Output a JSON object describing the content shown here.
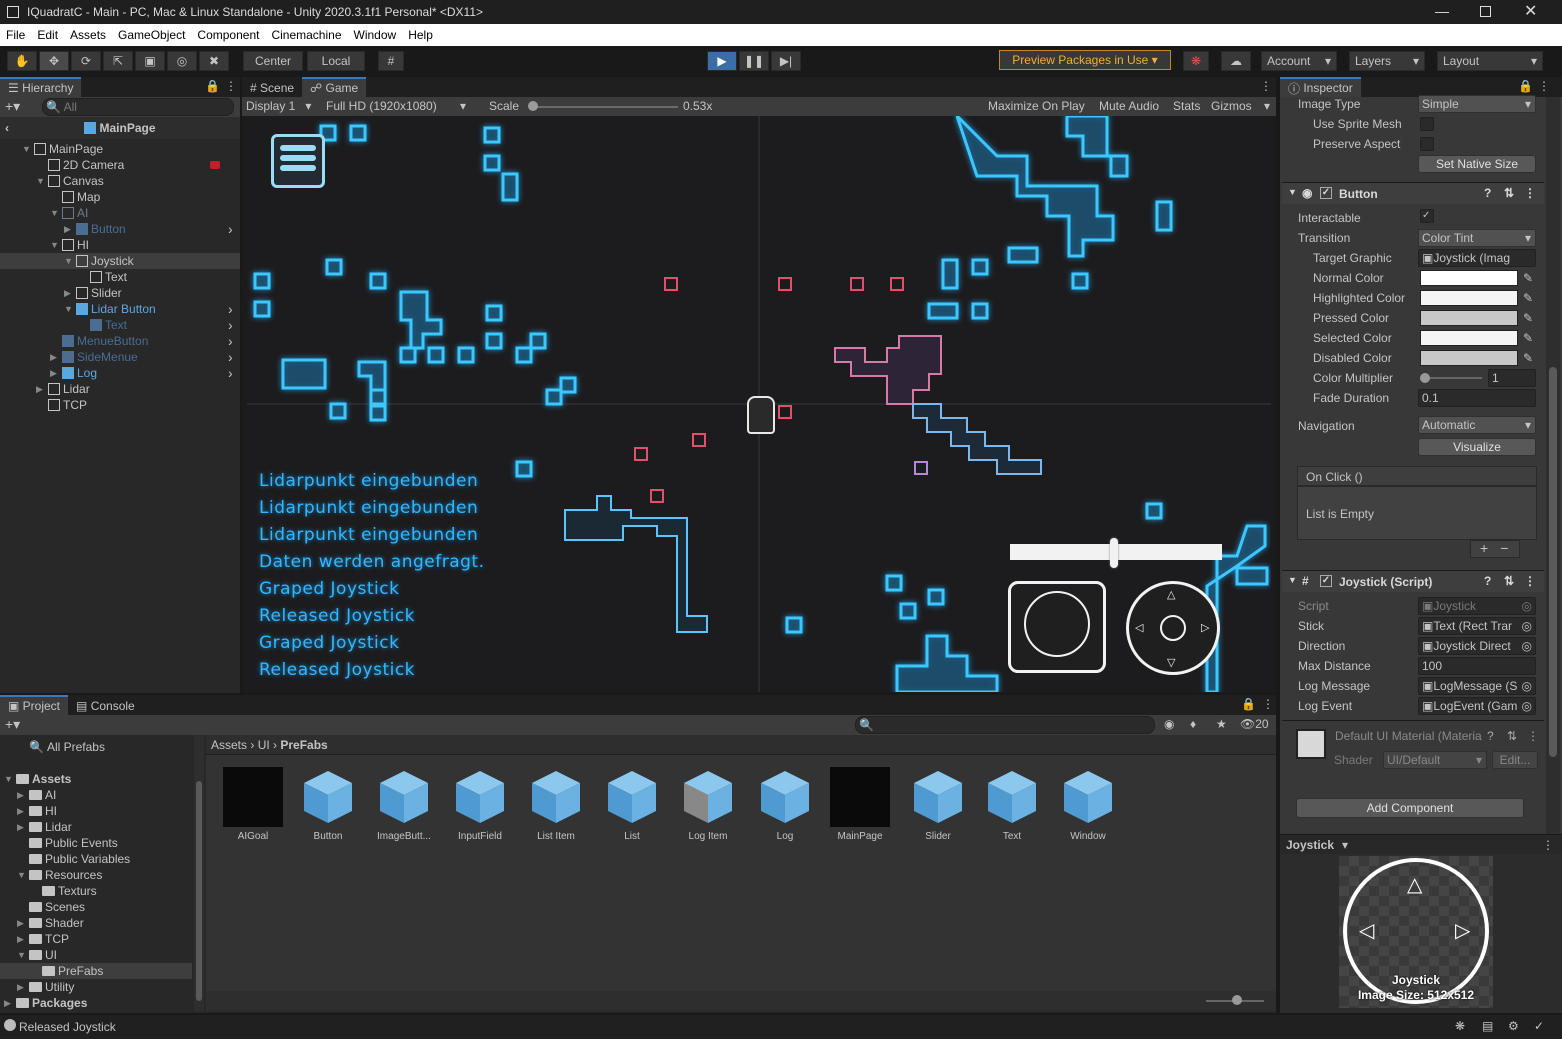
{
  "window": {
    "title": "IQuadratC - Main - PC, Mac & Linux Standalone - Unity 2020.3.1f1 Personal* <DX11>"
  },
  "menu": [
    "File",
    "Edit",
    "Assets",
    "GameObject",
    "Component",
    "Cinemachine",
    "Window",
    "Help"
  ],
  "toolbar": {
    "pivot": "Center",
    "space": "Local",
    "packages": "Preview Packages in Use",
    "account": "Account",
    "layers": "Layers",
    "layout": "Layout"
  },
  "hierarchy": {
    "tab": "Hierarchy",
    "search_placeholder": "All",
    "scene": "MainPage",
    "rows": [
      {
        "label": "MainPage",
        "indent": 0
      },
      {
        "label": "2D Camera",
        "indent": 1
      },
      {
        "label": "Canvas",
        "indent": 1
      },
      {
        "label": "Map",
        "indent": 2
      },
      {
        "label": "AI",
        "indent": 2
      },
      {
        "label": "Button",
        "indent": 3
      },
      {
        "label": "HI",
        "indent": 2
      },
      {
        "label": "Joystick",
        "indent": 3
      },
      {
        "label": "Text",
        "indent": 4
      },
      {
        "label": "Slider",
        "indent": 3
      },
      {
        "label": "Lidar Button",
        "indent": 3
      },
      {
        "label": "Text",
        "indent": 4
      },
      {
        "label": "MenueButton",
        "indent": 2
      },
      {
        "label": "SideMenue",
        "indent": 2
      },
      {
        "label": "Log",
        "indent": 2
      },
      {
        "label": "Lidar",
        "indent": 1
      },
      {
        "label": "TCP",
        "indent": 1
      }
    ]
  },
  "scene_tabs": {
    "scene": "Scene",
    "game": "Game"
  },
  "game_bar": {
    "display": "Display 1",
    "resolution": "Full HD (1920x1080)",
    "scale_label": "Scale",
    "scale_value": "0.53x",
    "maximize": "Maximize On Play",
    "mute": "Mute Audio",
    "stats": "Stats",
    "gizmos": "Gizmos"
  },
  "game_log": [
    "Lidarpunkt eingebunden",
    "Lidarpunkt eingebunden",
    "Lidarpunkt eingebunden",
    "Daten werden angefragt.",
    "Graped Joystick",
    "Released Joystick",
    "Graped Joystick",
    "Released Joystick"
  ],
  "inspector": {
    "tab": "Inspector",
    "image": {
      "image_type_label": "Image Type",
      "image_type": "Simple",
      "use_sprite_mesh": "Use Sprite Mesh",
      "preserve_aspect": "Preserve Aspect",
      "set_native": "Set Native Size"
    },
    "button": {
      "title": "Button",
      "interactable": "Interactable",
      "transition_label": "Transition",
      "transition": "Color Tint",
      "target_graphic_label": "Target Graphic",
      "target_graphic": "Joystick (Imag",
      "colors": [
        {
          "label": "Normal Color",
          "color": "#ffffff"
        },
        {
          "label": "Highlighted Color",
          "color": "#f5f5f5"
        },
        {
          "label": "Pressed Color",
          "color": "#c8c8c8"
        },
        {
          "label": "Selected Color",
          "color": "#f5f5f5"
        },
        {
          "label": "Disabled Color",
          "color": "#c8c8c8"
        }
      ],
      "color_multiplier_label": "Color Multiplier",
      "color_multiplier": "1",
      "fade_label": "Fade Duration",
      "fade": "0.1",
      "navigation_label": "Navigation",
      "navigation": "Automatic",
      "visualize": "Visualize",
      "onclick": "On Click ()",
      "list_empty": "List is Empty"
    },
    "joystick": {
      "title": "Joystick (Script)",
      "rows": [
        {
          "label": "Script",
          "value": "Joystick"
        },
        {
          "label": "Stick",
          "value": "Text (Rect Trar"
        },
        {
          "label": "Direction",
          "value": "Joystick Direct"
        },
        {
          "label": "Max Distance",
          "value": "100"
        },
        {
          "label": "Log Message",
          "value": "LogMessage (S"
        },
        {
          "label": "Log Event",
          "value": "LogEvent (Gam"
        }
      ]
    },
    "material": {
      "name": "Default UI Material (Materia",
      "shader_label": "Shader",
      "shader": "UI/Default",
      "edit": "Edit..."
    },
    "add_component": "Add Component",
    "preview": {
      "title": "Joystick",
      "name": "Joystick",
      "size": "Image Size: 512x512"
    }
  },
  "project": {
    "tabs": {
      "project": "Project",
      "console": "Console"
    },
    "hidden_count": "20",
    "breadcrumb": [
      "Assets",
      "UI",
      "PreFabs"
    ],
    "tree": [
      {
        "label": "All Prefabs",
        "indent": 1,
        "bold": false
      },
      {
        "label": "Assets",
        "indent": 0,
        "bold": true
      },
      {
        "label": "AI",
        "indent": 1,
        "bold": false
      },
      {
        "label": "HI",
        "indent": 1,
        "bold": false
      },
      {
        "label": "Lidar",
        "indent": 1,
        "bold": false
      },
      {
        "label": "Public Events",
        "indent": 1,
        "bold": false
      },
      {
        "label": "Public Variables",
        "indent": 1,
        "bold": false
      },
      {
        "label": "Resources",
        "indent": 1,
        "bold": false
      },
      {
        "label": "Texturs",
        "indent": 2,
        "bold": false
      },
      {
        "label": "Scenes",
        "indent": 1,
        "bold": false
      },
      {
        "label": "Shader",
        "indent": 1,
        "bold": false
      },
      {
        "label": "TCP",
        "indent": 1,
        "bold": false
      },
      {
        "label": "UI",
        "indent": 1,
        "bold": false
      },
      {
        "label": "PreFabs",
        "indent": 2,
        "bold": false
      },
      {
        "label": "Utility",
        "indent": 1,
        "bold": false
      },
      {
        "label": "Packages",
        "indent": 0,
        "bold": true
      }
    ],
    "assets": [
      "AIGoal",
      "Button",
      "ImageButt...",
      "InputField",
      "List Item",
      "List",
      "Log Item",
      "Log",
      "MainPage",
      "Slider",
      "Text",
      "Window"
    ]
  },
  "status": {
    "message": "Released Joystick"
  }
}
